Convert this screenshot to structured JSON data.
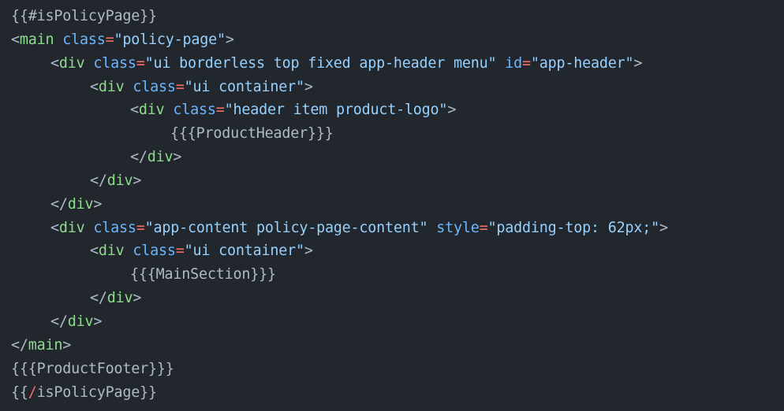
{
  "code": {
    "language": "handlebars-html",
    "lines": {
      "l1": {
        "open": "{{#",
        "name": "isPolicyPage",
        "close": "}}"
      },
      "l2": {
        "lt": "<",
        "tag": "main",
        "attr1": "class",
        "eq1": "=",
        "val1": "\"policy-page\"",
        "gt": ">"
      },
      "l3": {
        "lt": "<",
        "tag": "div",
        "attr1": "class",
        "eq1": "=",
        "val1": "\"ui borderless top fixed app-header menu\"",
        "attr2": "id",
        "eq2": "=",
        "val2": "\"app-header\"",
        "gt": ">"
      },
      "l4": {
        "lt": "<",
        "tag": "div",
        "attr1": "class",
        "eq1": "=",
        "val1": "\"ui container\"",
        "gt": ">"
      },
      "l5": {
        "lt": "<",
        "tag": "div",
        "attr1": "class",
        "eq1": "=",
        "val1": "\"header item product-logo\"",
        "gt": ">"
      },
      "l6": {
        "text": "{{{ProductHeader}}}"
      },
      "l7": {
        "lt": "</",
        "tag": "div",
        "gt": ">"
      },
      "l8": {
        "lt": "</",
        "tag": "div",
        "gt": ">"
      },
      "l9": {
        "lt": "</",
        "tag": "div",
        "gt": ">"
      },
      "l10": {
        "lt": "<",
        "tag": "div",
        "attr1": "class",
        "eq1": "=",
        "val1": "\"app-content policy-page-content\"",
        "attr2": "style",
        "eq2": "=",
        "val2": "\"padding-top: 62px;\"",
        "gt": ">"
      },
      "l11": {
        "lt": "<",
        "tag": "div",
        "attr1": "class",
        "eq1": "=",
        "val1": "\"ui container\"",
        "gt": ">"
      },
      "l12": {
        "text": "{{{MainSection}}}"
      },
      "l13": {
        "lt": "</",
        "tag": "div",
        "gt": ">"
      },
      "l14": {
        "lt": "</",
        "tag": "div",
        "gt": ">"
      },
      "l15": {
        "lt": "</",
        "tag": "main",
        "gt": ">"
      },
      "l16": {
        "text": "{{{ProductFooter}}}"
      },
      "l17": {
        "open": "{{",
        "slash": "/",
        "name": "isPolicyPage",
        "close": "}}"
      }
    }
  },
  "colors": {
    "background": "#22272e",
    "default_text": "#adbac7",
    "tag": "#8ddb8c",
    "attribute": "#6cb6ff",
    "string": "#96d0ff",
    "equals": "#f47067"
  }
}
